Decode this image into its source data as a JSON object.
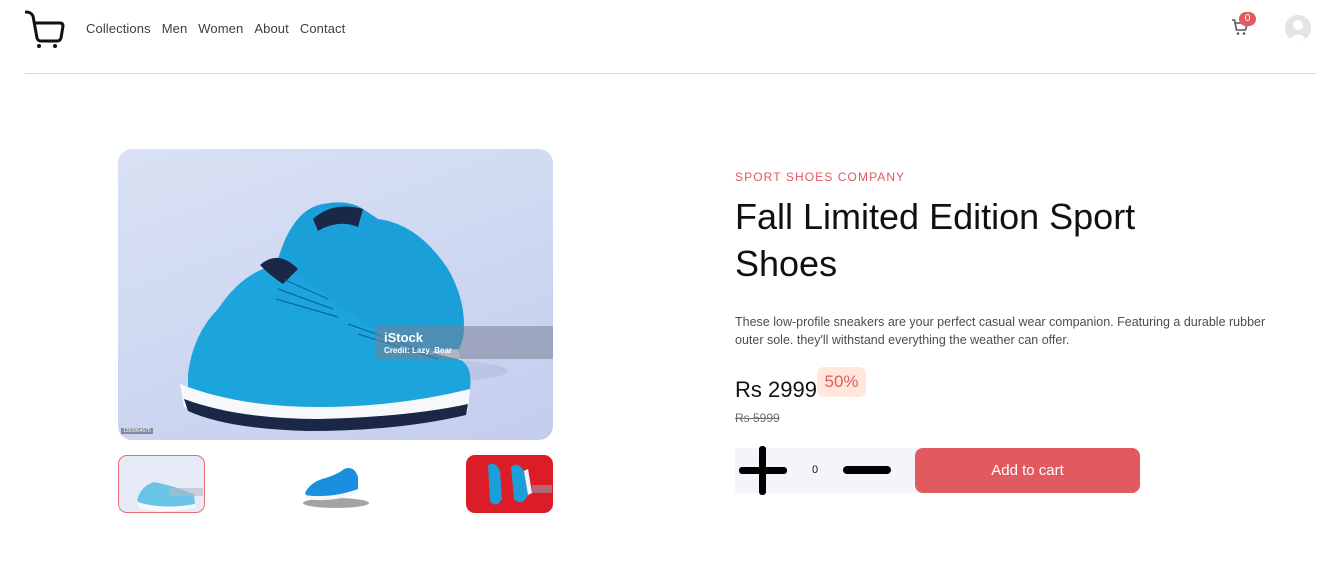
{
  "header": {
    "nav": [
      "Collections",
      "Men",
      "Women",
      "About",
      "Contact"
    ],
    "cart_count": "0"
  },
  "gallery": {
    "watermark_brand": "iStock",
    "watermark_credit": "Credit: Lazy_Bear",
    "image_id": "1355964575",
    "thumbnails": [
      "thumbnail-1",
      "thumbnail-2",
      "thumbnail-3"
    ],
    "selected_thumbnail": 1
  },
  "product": {
    "company": "SPORT SHOES COMPANY",
    "title": "Fall Limited Edition Sport Shoes",
    "description": "These low-profile sneakers are your perfect casual wear companion. Featuring a durable rubber outer sole. they'll withstand everything the weather can offer.",
    "price": "Rs 2999",
    "discount": "50%",
    "old_price": "Rs 5999",
    "quantity": "0",
    "add_to_cart_label": "Add to cart"
  },
  "colors": {
    "accent": "#e05a5f",
    "accent_light": "#ffe7dc",
    "qty_bg": "#f4f5fa",
    "shoe_blue": "#1a9fd9",
    "thumb3_bg": "#dc1d27"
  },
  "icons": [
    "cart-logo-icon",
    "cart-icon",
    "avatar-icon",
    "plus-icon",
    "minus-icon"
  ]
}
